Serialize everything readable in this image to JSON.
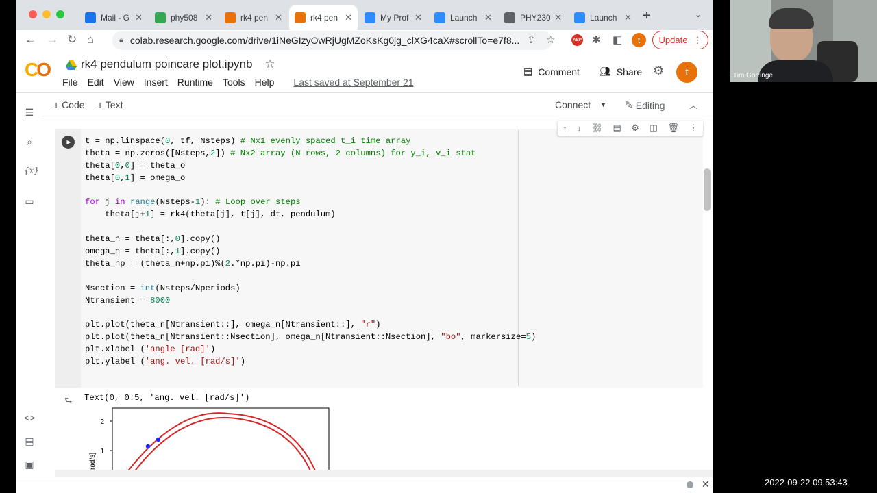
{
  "browser": {
    "tabs": [
      {
        "label": "Mail - G",
        "icon": "gmail-icon",
        "color": "#1a73e8"
      },
      {
        "label": "phy508",
        "icon": "drive-icon",
        "color": "#34a853"
      },
      {
        "label": "rk4 pen",
        "icon": "colab-icon",
        "color": "#e8710a"
      },
      {
        "label": "rk4 pen",
        "icon": "colab-icon",
        "color": "#e8710a",
        "active": true
      },
      {
        "label": "My Prof",
        "icon": "zoom-icon",
        "color": "#2d8cff"
      },
      {
        "label": "Launch",
        "icon": "zoom-icon",
        "color": "#2d8cff"
      },
      {
        "label": "PHY230",
        "icon": "globe-icon",
        "color": "#5f6368"
      },
      {
        "label": "Launch",
        "icon": "zoom-icon",
        "color": "#2d8cff"
      }
    ],
    "url": "colab.research.google.com/drive/1iNeGIzyOwRjUgMZoKsKg0jg_clXG4caX#scrollTo=e7f8...",
    "profile_initial": "t",
    "update_label": "Update"
  },
  "colab": {
    "title": "rk4 pendulum poincare plot.ipynb",
    "menu": [
      "File",
      "Edit",
      "View",
      "Insert",
      "Runtime",
      "Tools",
      "Help"
    ],
    "last_saved": "Last saved at September 21",
    "comment_label": "Comment",
    "share_label": "Share",
    "user_initial": "t",
    "add_code": "+ Code",
    "add_text": "+ Text",
    "connect_label": "Connect",
    "editing_label": "Editing"
  },
  "code_lines": [
    "t = np.linspace(0, tf, Nsteps) # Nx1 evenly spaced t_i time array",
    "theta = np.zeros([Nsteps,2]) # Nx2 array (N rows, 2 columns) for y_i, v_i stat",
    "theta[0,0] = theta_o",
    "theta[0,1] = omega_o",
    "",
    "for j in range(Nsteps-1): # Loop over steps",
    "    theta[j+1] = rk4(theta[j], t[j], dt, pendulum)",
    "",
    "theta_n = theta[:,0].copy()",
    "omega_n = theta[:,1].copy()",
    "theta_np = (theta_n+np.pi)%(2.*np.pi)-np.pi",
    "",
    "Nsection = int(Nsteps/Nperiods)",
    "Ntransient = 8000",
    "",
    "plt.plot(theta_n[Ntransient::], omega_n[Ntransient::], \"r\")",
    "plt.plot(theta_n[Ntransient::Nsection], omega_n[Ntransient::Nsection], \"bo\", markersize=5)",
    "plt.xlabel ('angle [rad]')",
    "plt.ylabel ('ang. vel. [rad/s]')"
  ],
  "output_text": "Text(0, 0.5, 'ang. vel. [rad/s]')",
  "chart_data": {
    "type": "line",
    "ylabel": "rad/s]",
    "yticks": [
      2,
      1
    ],
    "series": [
      {
        "style": "red-line"
      },
      {
        "style": "blue-dots"
      }
    ]
  },
  "webcam": {
    "name": "Tim Gorringe"
  },
  "clock": "2022-09-22 09:53:43"
}
